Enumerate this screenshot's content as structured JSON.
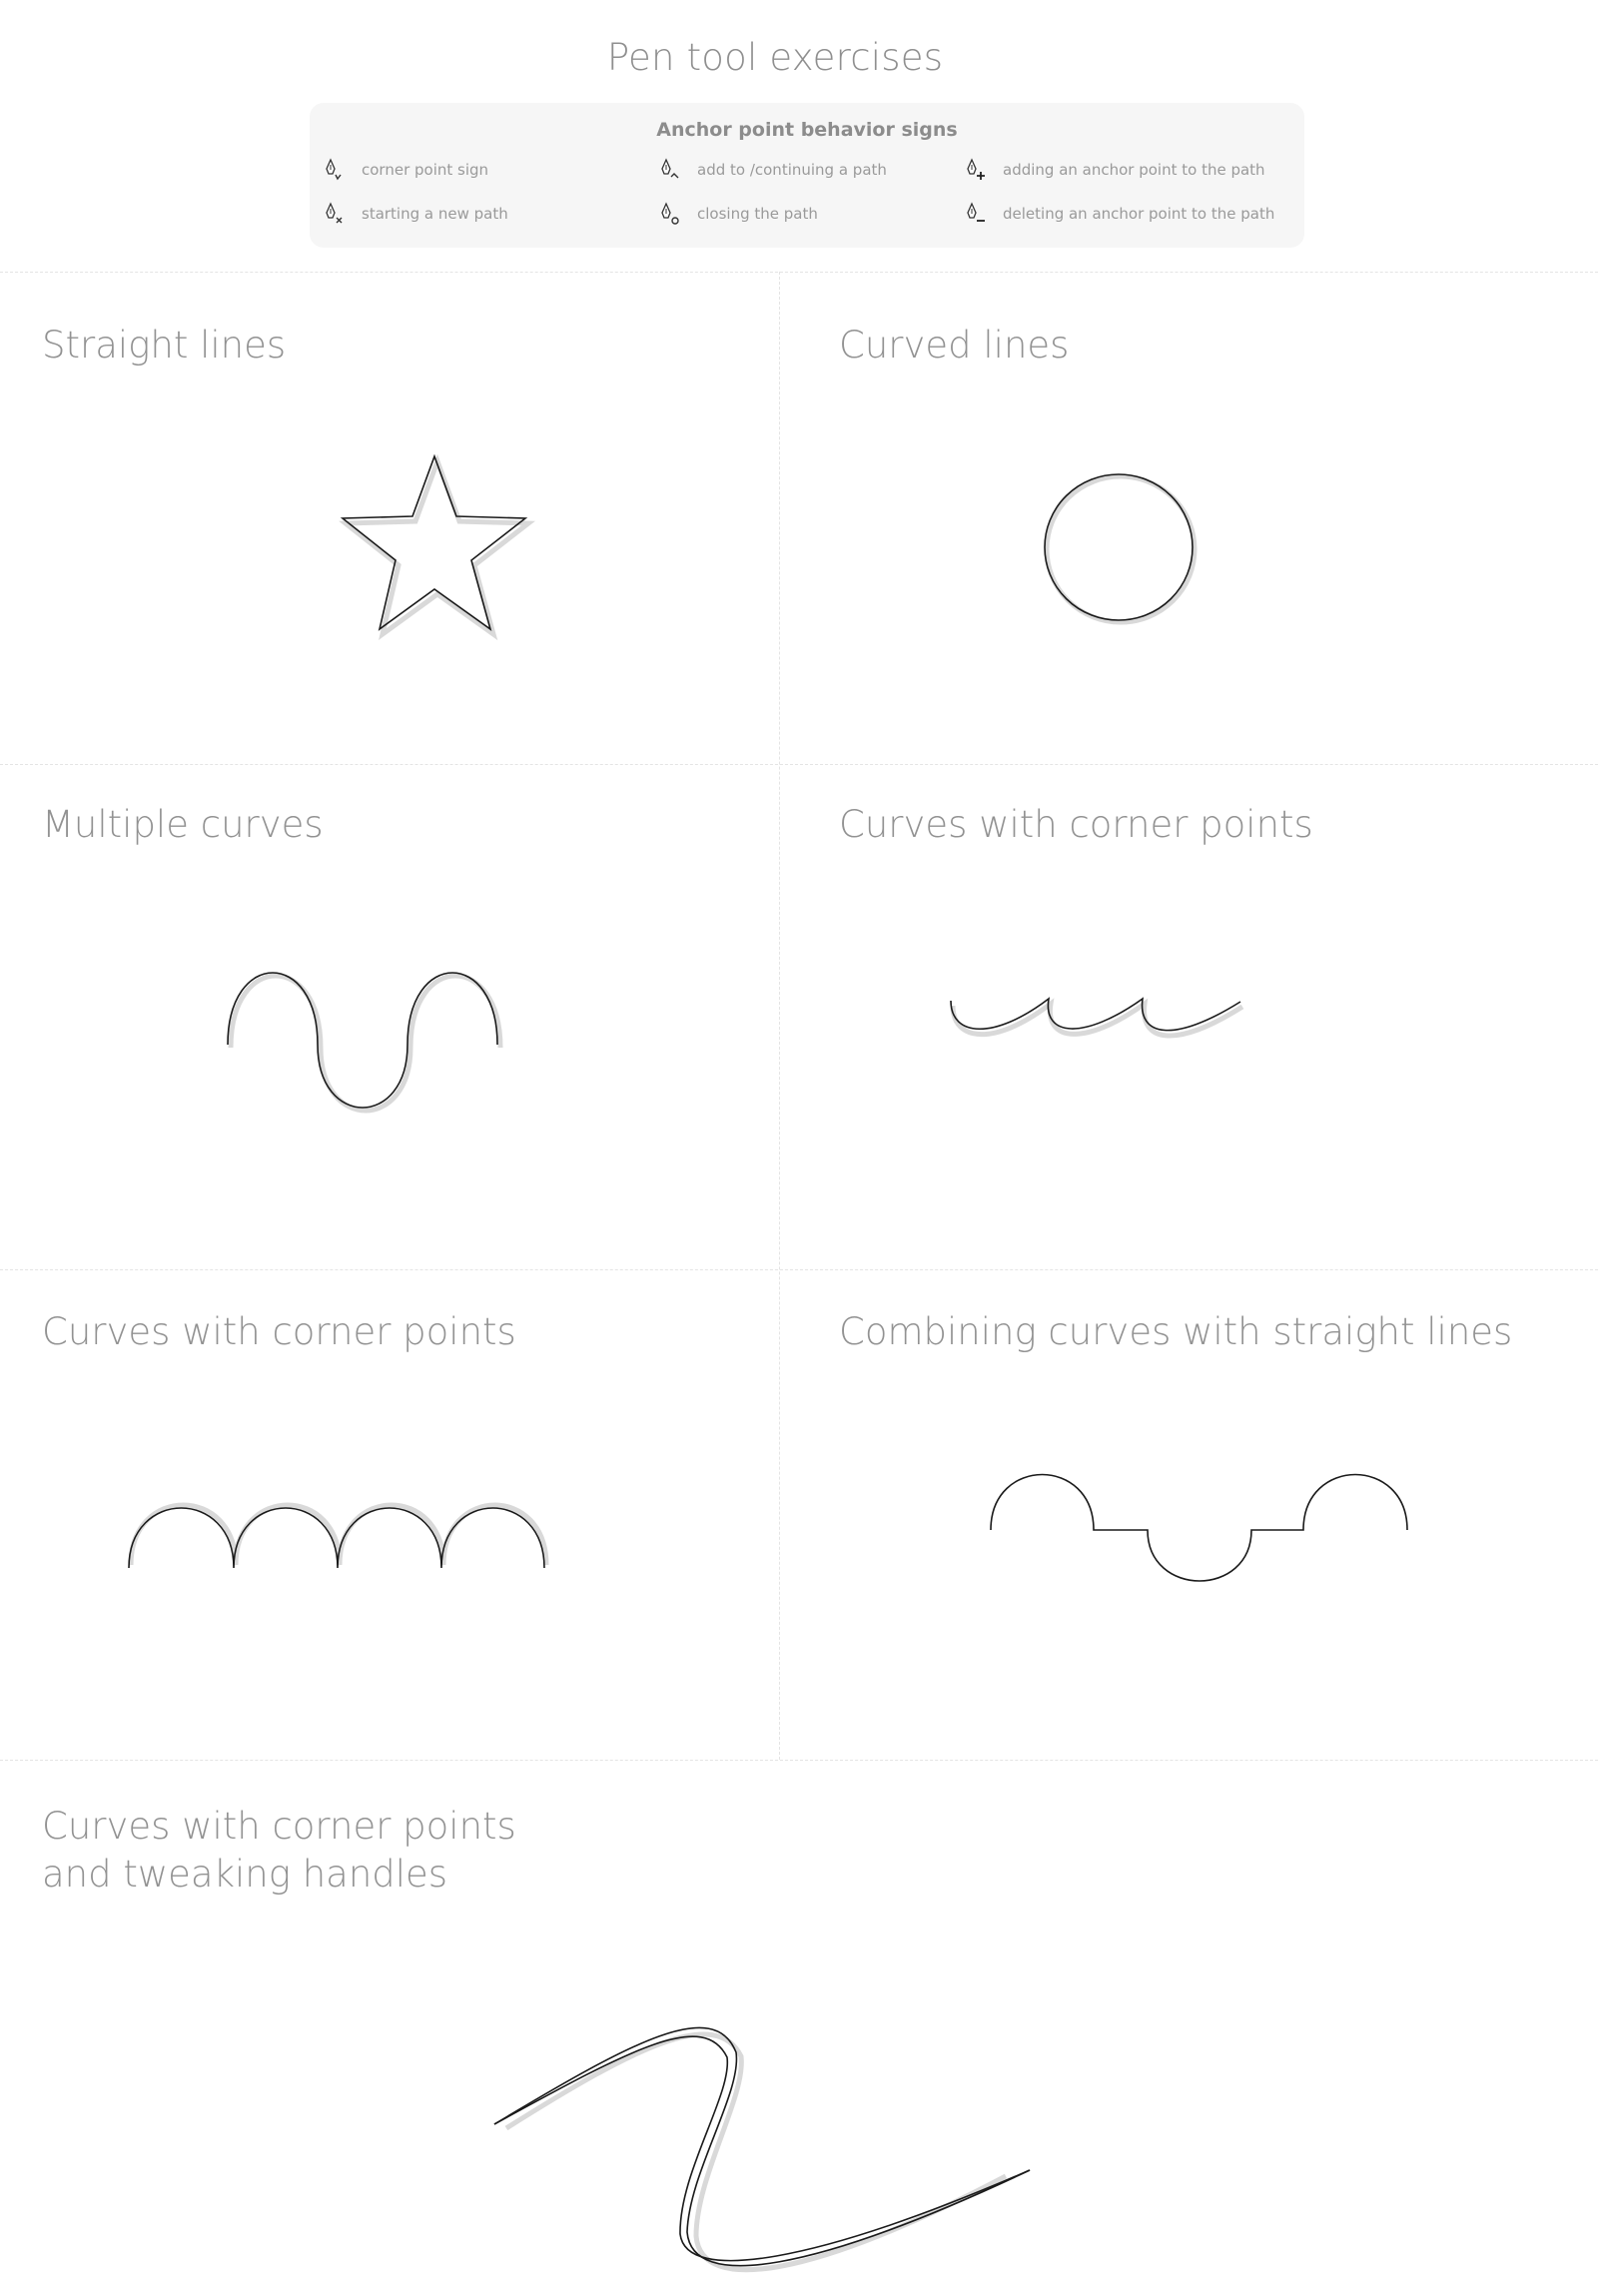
{
  "header": {
    "title": "Pen tool exercises"
  },
  "legend": {
    "title": "Anchor point behavior signs",
    "items": [
      {
        "label": "corner point sign",
        "icon": "pen-corner-icon"
      },
      {
        "label": "add to /continuing a path",
        "icon": "pen-continue-icon"
      },
      {
        "label": "adding an anchor point to the path",
        "icon": "pen-add-icon"
      },
      {
        "label": "starting a new path",
        "icon": "pen-new-icon"
      },
      {
        "label": "closing the path",
        "icon": "pen-close-icon"
      },
      {
        "label": "deleting an anchor point to the path",
        "icon": "pen-delete-icon"
      }
    ]
  },
  "exercises": [
    {
      "title": "Straight lines",
      "shape": "star"
    },
    {
      "title": "Curved lines",
      "shape": "circle"
    },
    {
      "title": "Multiple curves",
      "shape": "s-wave"
    },
    {
      "title": "Curves with corner points",
      "shape": "cusped-wave"
    },
    {
      "title": "Curves with corner points",
      "shape": "arches"
    },
    {
      "title": "Combining curves with straight lines",
      "shape": "arch-step-line"
    },
    {
      "title_lines": [
        "Curves with corner points",
        "and tweaking handles"
      ],
      "shape": "z-curve"
    }
  ],
  "colors": {
    "background": "#ffffff",
    "legend_background": "#f6f6f6",
    "text": "#8f8f8f",
    "stroke": "#1a1a1a",
    "divider": "#e4e4e4"
  }
}
